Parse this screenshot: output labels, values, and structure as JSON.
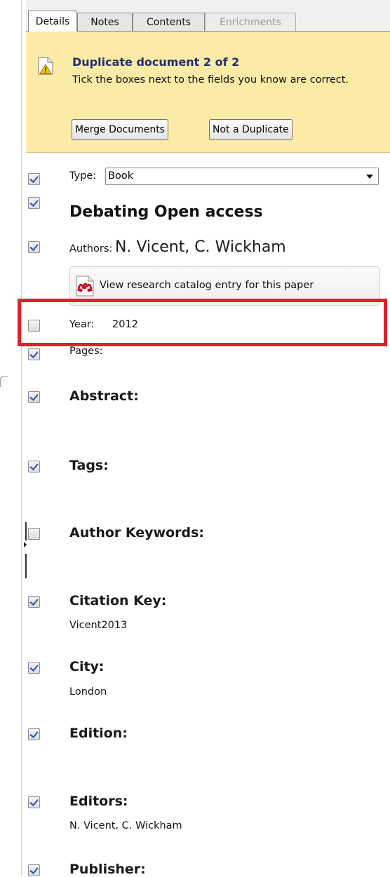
{
  "tabs": [
    {
      "label": "Details",
      "active": true,
      "enabled": true
    },
    {
      "label": "Notes",
      "active": false,
      "enabled": true
    },
    {
      "label": "Contents",
      "active": false,
      "enabled": true
    },
    {
      "label": "Enrichments",
      "active": false,
      "enabled": false
    }
  ],
  "duplicate_banner": {
    "icon": "document-warning-icon",
    "title": "Duplicate document 2 of 2",
    "message": "Tick the boxes next to the fields you know are correct.",
    "merge_button": "Merge Documents",
    "not_duplicate_button": "Not a Duplicate",
    "background_color": "#fbeba6"
  },
  "fields": {
    "type": {
      "label": "Type:",
      "value": "Book",
      "checked": true
    },
    "title": {
      "value": "Debating Open access",
      "checked": true
    },
    "authors": {
      "label": "Authors:",
      "value": "N. Vicent, C. Wickham",
      "checked": true
    },
    "catalog_link": {
      "icon": "mendeley-catalog-icon",
      "text": "View research catalog entry for this paper"
    },
    "year": {
      "label": "Year:",
      "value": "2012",
      "checked": false,
      "highlighted": true
    },
    "pages": {
      "label": "Pages:",
      "checked": true
    },
    "abstract": {
      "label": "Abstract:",
      "checked": true
    },
    "tags": {
      "label": "Tags:",
      "checked": true
    },
    "author_keywords": {
      "label": "Author Keywords:",
      "checked": false
    },
    "citation_key": {
      "label": "Citation Key:",
      "value": "Vicent2013",
      "checked": true
    },
    "city": {
      "label": "City:",
      "value": "London",
      "checked": true
    },
    "edition": {
      "label": "Edition:",
      "checked": true
    },
    "editors": {
      "label": "Editors:",
      "value": "N. Vicent, C. Wickham",
      "checked": true
    },
    "publisher": {
      "label": "Publisher:",
      "checked": true
    }
  },
  "highlight_color": "#e0202a",
  "checkmark_color": "#2a55b0"
}
